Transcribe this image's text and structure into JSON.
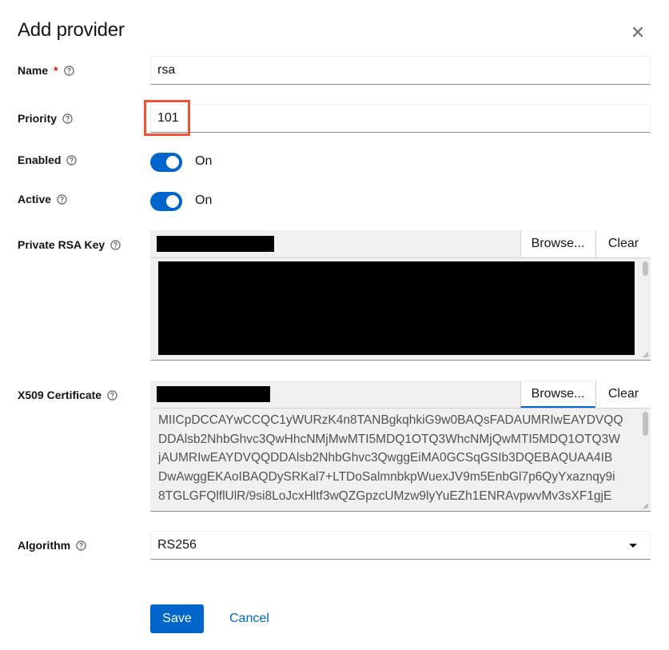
{
  "modal": {
    "title": "Add provider",
    "close_icon": "close-icon"
  },
  "form": {
    "name": {
      "label": "Name",
      "required_mark": "*",
      "value": "rsa"
    },
    "priority": {
      "label": "Priority",
      "value": "101"
    },
    "enabled": {
      "label": "Enabled",
      "state": "On",
      "on": true
    },
    "active": {
      "label": "Active",
      "state": "On",
      "on": true
    },
    "private_key": {
      "label": "Private RSA Key",
      "browse_label": "Browse...",
      "clear_label": "Clear"
    },
    "certificate": {
      "label": "X509 Certificate",
      "browse_label": "Browse...",
      "clear_label": "Clear",
      "text": "MIICpDCCAYwCCQC1yWURzK4n8TANBgkqhkiG9w0BAQsFADAUMRIwEAYDVQQ\nDDAlsb2NhbGhvc3QwHhcNMjMwMTI5MDQ1OTQ3WhcNMjQwMTI5MDQ1OTQ3W\njAUMRIwEAYDVQQDDAlsb2NhbGhvc3QwggEiMA0GCSqGSIb3DQEBAQUAA4IB\nDwAwggEKAoIBAQDySRKal7+LTDoSalmnbkpWuexJV9m5EnbGl7p6QyYxaznqy9i\n8TGLGFQlflUlR/9si8LoJcxHltf3wQZGpzcUMzw9lyYuEZh1ENRAvpwvMv3sXF1gjE"
    },
    "algorithm": {
      "label": "Algorithm",
      "value": "RS256"
    }
  },
  "actions": {
    "save_label": "Save",
    "cancel_label": "Cancel"
  },
  "colors": {
    "primary": "#0066cc",
    "required": "#c9190b",
    "highlight": "#ee5533"
  }
}
